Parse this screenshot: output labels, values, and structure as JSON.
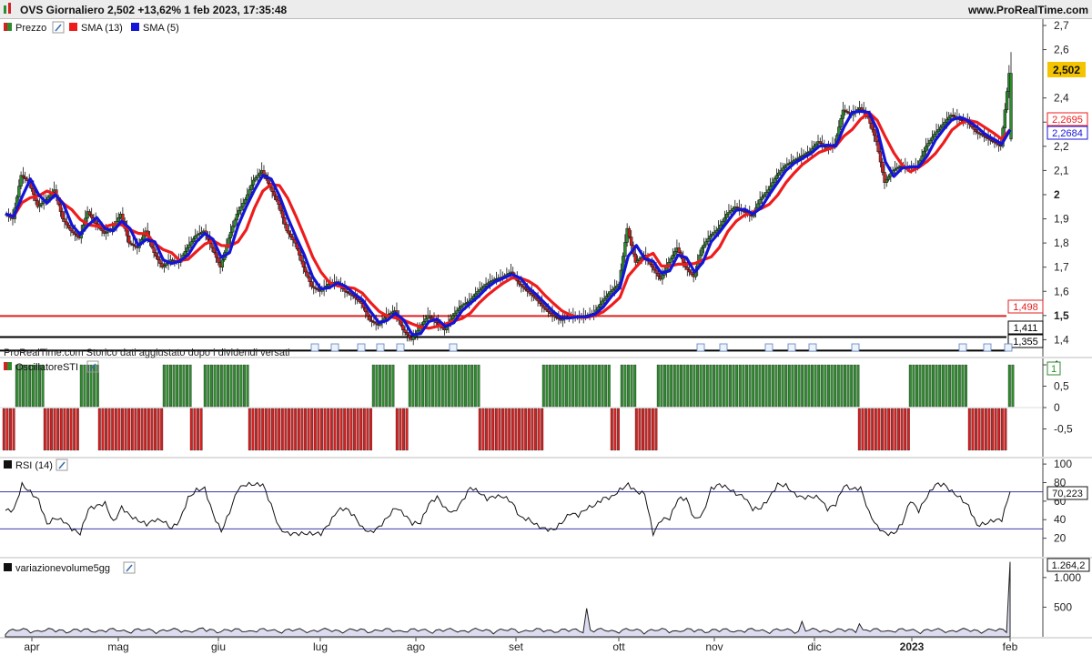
{
  "header": {
    "title": "OVS Giornaliero 2,502 +13,62% 1 feb 2023, 17:35:48",
    "brand": "www.ProRealTime.com"
  },
  "colors": {
    "up": "#2e8b2e",
    "down": "#d42020",
    "sma13": "#ee1c1c",
    "sma5": "#1414d8",
    "last_price_bg": "#f5c400",
    "axis": "#444444",
    "rsi_band": "#3a3aa8",
    "vol_fill": "#dcdcf0"
  },
  "price_panel": {
    "legend": [
      {
        "label": "Prezzo",
        "color": "#2e8b2e",
        "icon": "wrench-icon"
      },
      {
        "label": "SMA (13)",
        "color": "#ee1c1c"
      },
      {
        "label": "SMA (5)",
        "color": "#1414d8"
      }
    ],
    "y_ticks": [
      "2,7",
      "2,6",
      "2,4",
      "2,3",
      "2,2",
      "2,1",
      "2",
      "1,9",
      "1,8",
      "1,7",
      "1,6",
      "1,5",
      "1,4"
    ],
    "bold_ticks": [
      "2",
      "1,5"
    ],
    "last_price": "2,502",
    "sma13_value": "2,2695",
    "sma5_value": "2,2684",
    "h_lines": [
      {
        "label": "1,498",
        "value": 1.498,
        "color": "#e02020"
      },
      {
        "label": "1,411",
        "value": 1.411,
        "color": "#000000"
      },
      {
        "label": "1,355",
        "value": 1.355,
        "color": "#000000"
      }
    ],
    "note": "ProRealTime.com  Storico dati aggiustato dopo i dividendi versati"
  },
  "sti_panel": {
    "legend": {
      "label": "OscillatoreSTI",
      "icon": "wrench-icon"
    },
    "y_ticks": [
      "1",
      "0,5",
      "0",
      "-0,5"
    ],
    "last_value": "1"
  },
  "rsi_panel": {
    "legend": {
      "label": "RSI (14)",
      "icon": "wrench-icon"
    },
    "y_ticks": [
      "100",
      "80",
      "60",
      "40",
      "20"
    ],
    "last_value": "70,223"
  },
  "vol_panel": {
    "legend": {
      "label": "variazionevolume5gg",
      "icon": "wrench-icon"
    },
    "y_ticks": [
      "1.000",
      "500"
    ],
    "last_value": "1.264,2"
  },
  "x_axis": {
    "months": [
      "apr",
      "mag",
      "giu",
      "lug",
      "ago",
      "set",
      "ott",
      "nov",
      "dic",
      "2023",
      "feb"
    ],
    "bold": [
      "2023"
    ]
  },
  "chart_data": [
    {
      "type": "candlestick",
      "title": "OVS Giornaliero",
      "ylim": [
        1.33,
        2.73
      ],
      "series": [
        {
          "name": "Prezzo",
          "close": [
            1.92,
            1.9,
            2.08,
            2.05,
            1.95,
            1.98,
            2.02,
            1.9,
            1.85,
            1.82,
            1.93,
            1.88,
            1.84,
            1.86,
            1.92,
            1.8,
            1.78,
            1.85,
            1.76,
            1.7,
            1.73,
            1.72,
            1.78,
            1.83,
            1.85,
            1.78,
            1.7,
            1.82,
            1.92,
            1.98,
            2.06,
            2.1,
            2.03,
            1.96,
            1.85,
            1.8,
            1.7,
            1.62,
            1.6,
            1.63,
            1.64,
            1.6,
            1.58,
            1.55,
            1.48,
            1.46,
            1.5,
            1.52,
            1.44,
            1.4,
            1.45,
            1.5,
            1.47,
            1.44,
            1.5,
            1.54,
            1.56,
            1.6,
            1.63,
            1.65,
            1.66,
            1.68,
            1.63,
            1.6,
            1.57,
            1.53,
            1.5,
            1.48,
            1.5,
            1.49,
            1.5,
            1.51,
            1.56,
            1.6,
            1.63,
            1.86,
            1.72,
            1.75,
            1.7,
            1.65,
            1.72,
            1.78,
            1.7,
            1.66,
            1.78,
            1.83,
            1.86,
            1.92,
            1.95,
            1.93,
            1.91,
            1.98,
            2.02,
            2.08,
            2.12,
            2.14,
            2.16,
            2.18,
            2.22,
            2.19,
            2.21,
            2.35,
            2.33,
            2.36,
            2.32,
            2.22,
            2.05,
            2.1,
            2.12,
            2.11,
            2.12,
            2.2,
            2.25,
            2.29,
            2.33,
            2.31,
            2.3,
            2.26,
            2.24,
            2.22,
            2.2,
            2.502
          ]
        },
        {
          "name": "SMA (13)",
          "values": [
            1.9,
            1.92,
            1.96,
            1.97,
            1.96,
            1.95,
            1.94,
            1.93,
            1.9,
            1.88,
            1.87,
            1.85,
            1.84,
            1.83,
            1.82,
            1.8,
            1.78,
            1.77,
            1.77,
            1.77,
            1.77,
            1.78,
            1.81,
            1.86,
            1.92,
            1.97,
            2.0,
            1.96,
            1.88,
            1.8,
            1.73,
            1.66,
            1.61,
            1.56,
            1.52,
            1.5,
            1.48,
            1.47,
            1.46,
            1.46,
            1.47,
            1.49,
            1.53,
            1.57,
            1.6,
            1.61,
            1.6,
            1.58,
            1.55,
            1.52,
            1.5,
            1.51,
            1.54,
            1.58,
            1.63,
            1.68,
            1.72,
            1.75,
            1.79,
            1.84,
            1.9,
            1.94,
            1.97,
            2.02,
            2.07,
            2.1,
            2.13,
            2.16,
            2.19,
            2.22,
            2.26,
            2.24,
            2.19,
            2.15,
            2.13,
            2.14,
            2.18,
            2.22,
            2.24,
            2.26,
            2.25,
            2.23,
            2.2,
            2.2,
            2.25
          ]
        }
      ]
    },
    {
      "type": "bar",
      "title": "OscillatoreSTI",
      "ylim": [
        -1,
        1
      ],
      "values_sign": "alternating +1 / -1 histogram"
    },
    {
      "type": "line",
      "title": "RSI (14)",
      "ylim": [
        0,
        100
      ],
      "bands": [
        70,
        30
      ],
      "last": 70.223
    },
    {
      "type": "area",
      "title": "variazionevolume5gg",
      "ylim": [
        0,
        1300
      ],
      "last": 1264.2
    }
  ]
}
